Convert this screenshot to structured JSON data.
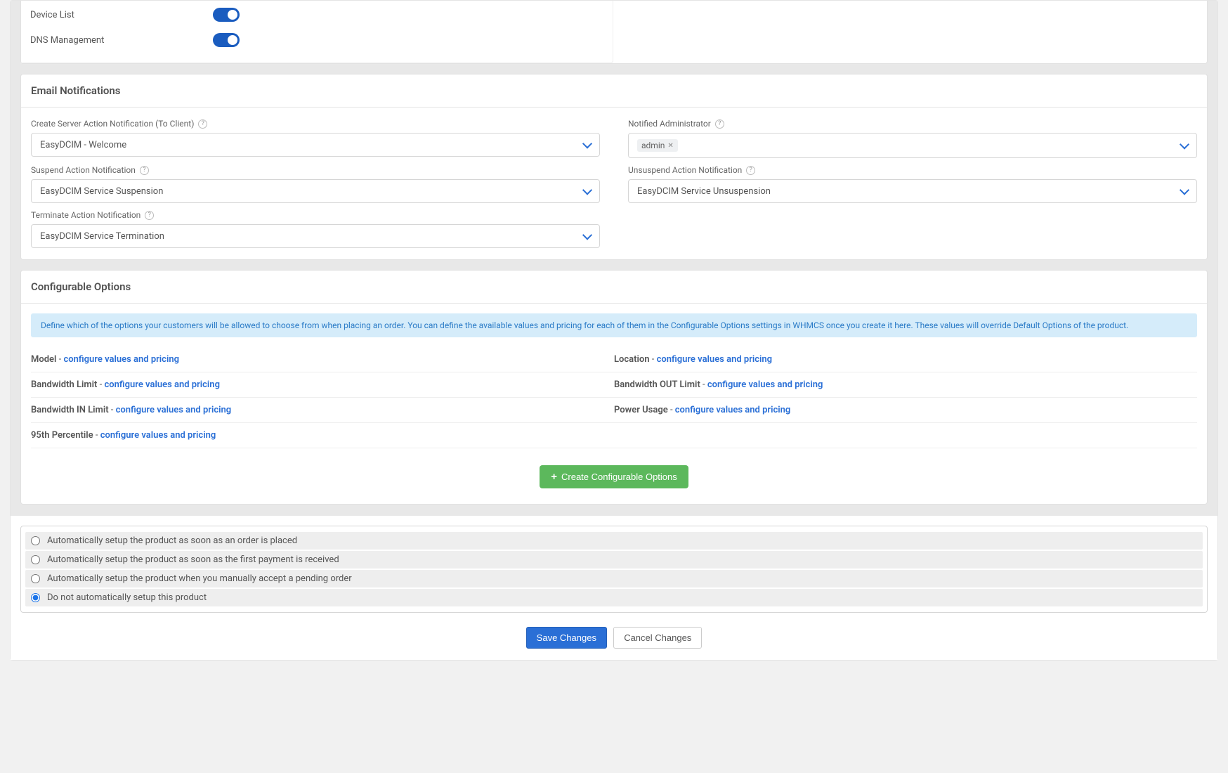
{
  "toggles": {
    "device_list_label": "Device List",
    "dns_mgmt_label": "DNS Management"
  },
  "email_notifications": {
    "title": "Email Notifications",
    "create_server_label": "Create Server Action Notification (To Client)",
    "create_server_value": "EasyDCIM - Welcome",
    "notified_admin_label": "Notified Administrator",
    "notified_admin_tag": "admin",
    "suspend_label": "Suspend Action Notification",
    "suspend_value": "EasyDCIM Service Suspension",
    "unsuspend_label": "Unsuspend Action Notification",
    "unsuspend_value": "EasyDCIM Service Unsuspension",
    "terminate_label": "Terminate Action Notification",
    "terminate_value": "EasyDCIM Service Termination"
  },
  "configurable_options": {
    "title": "Configurable Options",
    "info_text": "Define which of the options your customers will be allowed to choose from when placing an order. You can define the available values and pricing for each of them in the Configurable Options settings in WHMCS once you create it here. These values will override Default Options of the product.",
    "link_text": "configure values and pricing",
    "items": {
      "model": "Model",
      "location": "Location",
      "bw_limit": "Bandwidth Limit",
      "bw_out": "Bandwidth OUT Limit",
      "bw_in": "Bandwidth IN Limit",
      "power": "Power Usage",
      "p95": "95th Percentile"
    },
    "create_button": "Create Configurable Options"
  },
  "auto_setup": {
    "opt1": "Automatically setup the product as soon as an order is placed",
    "opt2": "Automatically setup the product as soon as the first payment is received",
    "opt3": "Automatically setup the product when you manually accept a pending order",
    "opt4": "Do not automatically setup this product"
  },
  "footer": {
    "save": "Save Changes",
    "cancel": "Cancel Changes"
  }
}
